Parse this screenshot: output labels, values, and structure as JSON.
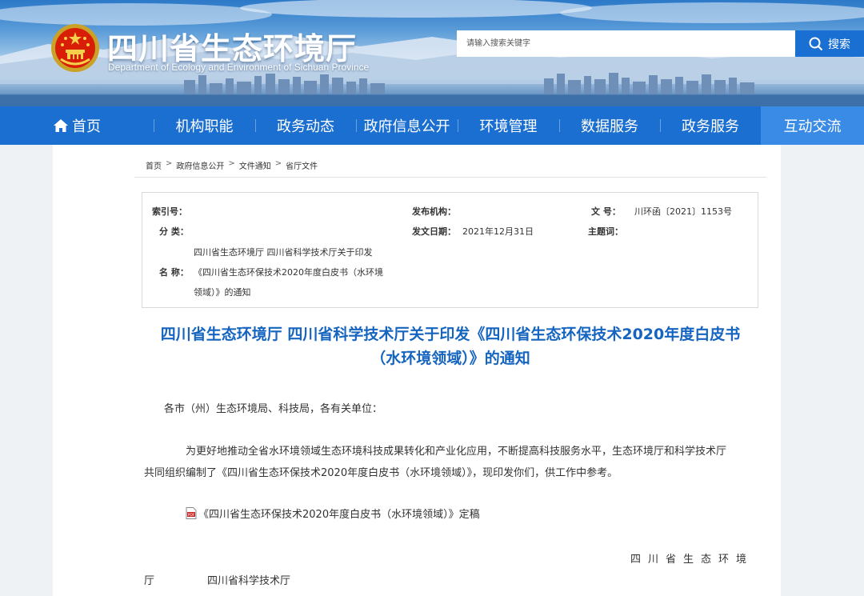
{
  "header": {
    "site_title": "四川省生态环境厅",
    "site_subtitle": "Department of Ecology and Environment of Sichuan Province",
    "search_placeholder": "请输入搜索关键字",
    "search_button": "搜索"
  },
  "nav": [
    {
      "label": "首页",
      "icon": "home-icon"
    },
    {
      "label": "机构职能"
    },
    {
      "label": "政务动态"
    },
    {
      "label": "政府信息公开"
    },
    {
      "label": "环境管理"
    },
    {
      "label": "数据服务"
    },
    {
      "label": "政务服务"
    },
    {
      "label": "互动交流",
      "active": true
    }
  ],
  "breadcrumb": [
    "首页",
    "政府信息公开",
    "文件通知",
    "省厅文件"
  ],
  "meta": {
    "index_label": "索引号：",
    "index_value": "",
    "publisher_label": "发布机构：",
    "publisher_value": "",
    "docno_label": "文 号：",
    "docno_value": "川环函〔2021〕1153号",
    "category_label": "分 类：",
    "category_value": "",
    "date_label": "发文日期：",
    "date_value": "2021年12月31日",
    "subject_label": "主题词：",
    "subject_value": "",
    "name_label": "名 称：",
    "name_lines": [
      "四川省生态环境厅 四川省科学技术厅关于印发",
      "《四川省生态环保技术2020年度白皮书（水环境",
      "领域）》的通知"
    ]
  },
  "document": {
    "title_lines": [
      "四川省生态环境厅 四川省科学技术厅关于印发《四川省生态环保技术2020年度白皮书",
      "（水环境领域）》的通知"
    ],
    "salutation": "各市（州）生态环境局、科技局，各有关单位：",
    "body_line1": "为更好地推动全省水环境领域生态环境科技成果转化和产业化应用，不断提高科技服务水平，生态环境厅和科学技术厅",
    "body_line2": "共同组织编制了《四川省生态环保技术2020年度白皮书（水环境领域）》，现印发你们，供工作中参考。",
    "attachment": "《四川省生态环保技术2020年度白皮书（水环境领域）》定稿",
    "signature_line1": "四川省生态环境",
    "signature_line2a": "厅",
    "signature_line2b": "四川省科学技术厅"
  },
  "colors": {
    "nav_bg": "#1b6fd0",
    "nav_active": "#3a8be6",
    "title_blue": "#1565c0",
    "search_button": "#1a6fd3"
  }
}
